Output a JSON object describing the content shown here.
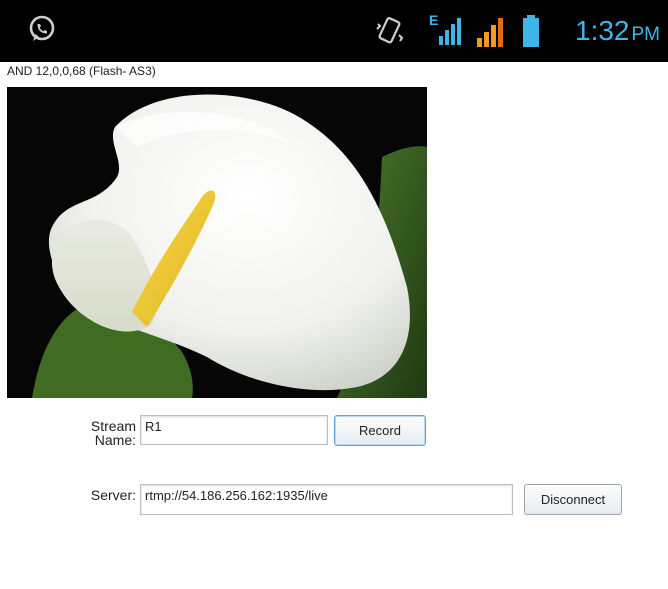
{
  "status_bar": {
    "time": "1:32",
    "ampm": "PM",
    "network_type": "E",
    "icons": [
      "whatsapp-icon",
      "vibrate-icon",
      "signal-sim1-icon",
      "signal-sim2-icon",
      "battery-icon"
    ],
    "colors": {
      "clock": "#3db5e6",
      "signal_sim1": "#3db5e6",
      "signal_sim2": "#f59b1a",
      "battery": "#3db5e6"
    }
  },
  "app": {
    "version_text": "AND 12,0,0,68 (Flash- AS3)"
  },
  "stream": {
    "label_line1": "Stream",
    "label_line2": "Name:",
    "value": "R1",
    "record_label": "Record"
  },
  "server": {
    "label": "Server:",
    "value": "rtmp://54.186.256.162:1935/live",
    "disconnect_label": "Disconnect"
  }
}
